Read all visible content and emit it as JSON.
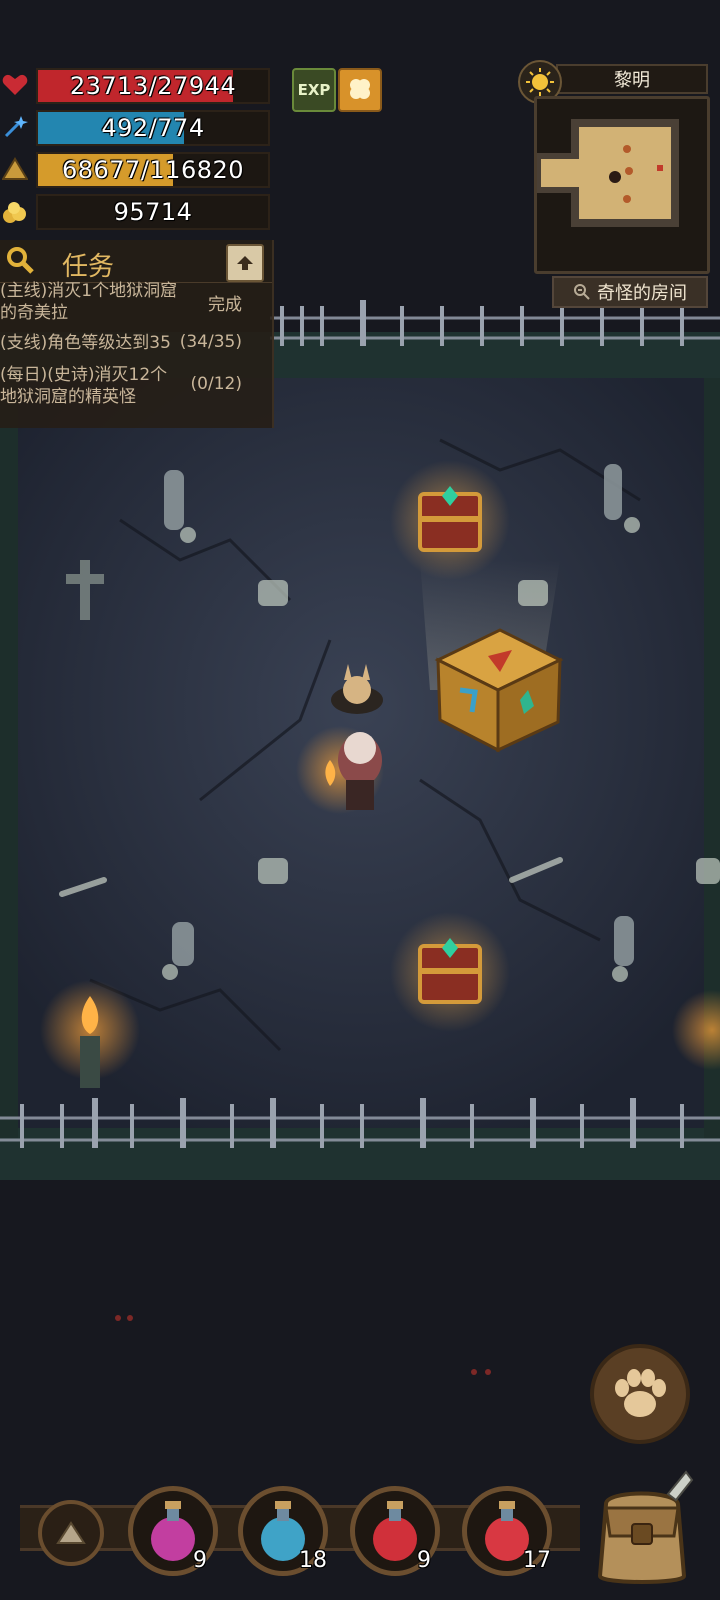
{
  "stats": {
    "hp": {
      "text": "23713/27944",
      "fraction": 0.849,
      "color": "#c0262c"
    },
    "mp": {
      "text": "492/774",
      "fraction": 0.636,
      "color": "#2386b0"
    },
    "xp": {
      "text": "68677/116820",
      "fraction": 0.588,
      "color": "#d59b2b"
    },
    "gold": {
      "text": "95714"
    }
  },
  "boosts": {
    "exp_label": "EXP"
  },
  "quests": {
    "title": "任务",
    "items": [
      {
        "text": "(主线)消灭1个地狱洞窟的奇美拉",
        "status": "完成"
      },
      {
        "text": "(支线)角色等级达到35",
        "status": "(34/35)"
      },
      {
        "text": "(每日)(史诗)消灭12个地狱洞窟的精英怪",
        "status": "(0/12)"
      }
    ]
  },
  "minimap": {
    "time_of_day": "黎明",
    "room_name": "奇怪的房间"
  },
  "potions": [
    {
      "name": "purple-potion",
      "count": "9",
      "color": "#c23ea0"
    },
    {
      "name": "blue-potion",
      "count": "18",
      "color": "#3fa3c7"
    },
    {
      "name": "red-potion",
      "count": "9",
      "color": "#d0303a"
    },
    {
      "name": "red-potion-large",
      "count": "17",
      "color": "#d83842"
    }
  ]
}
